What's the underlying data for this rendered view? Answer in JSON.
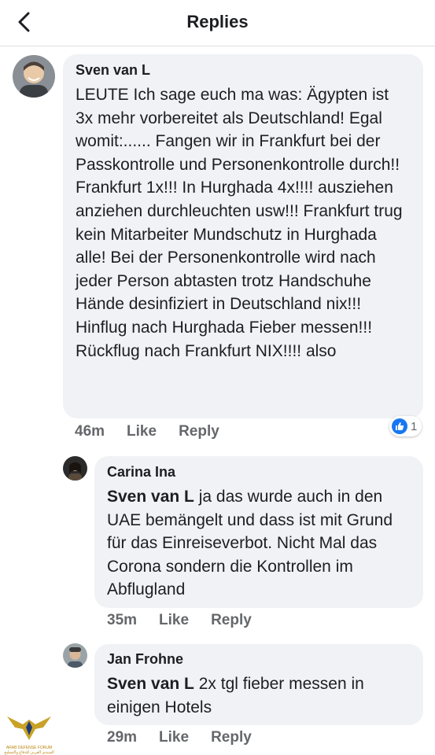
{
  "header": {
    "title": "Replies"
  },
  "comments": [
    {
      "author": "Sven van L",
      "text": "LEUTE Ich sage euch ma was: Ägypten ist 3x mehr vorbereitet als Deutschland! Egal womit:...... Fangen wir in Frankfurt bei der Passkontrolle und Personenkontrolle durch!!  Frankfurt 1x!!!  In Hurghada 4x!!!! ausziehen anziehen durchleuchten usw!!! Frankfurt trug kein Mitarbeiter Mundschutz in Hurghada alle! Bei der Personenkontrolle wird nach jeder Person abtasten trotz Handschuhe Hände desinfiziert in Deutschland nix!!! Hinflug nach Hurghada Fieber messen!!! Rückflug nach Frankfurt NIX!!!!  also",
      "time": "46m",
      "like": "Like",
      "reply": "Reply",
      "reaction_count": "1"
    },
    {
      "author": "Carina Ina",
      "mention": "Sven van L",
      "text": " ja das wurde auch in den UAE bemängelt und dass ist mit Grund für das Einreiseverbot. Nicht Mal das Corona sondern die Kontrollen im Abflugland",
      "time": "35m",
      "like": "Like",
      "reply": "Reply"
    },
    {
      "author": "Jan Frohne",
      "mention": "Sven van L",
      "text": " 2x tgl fieber messen in einigen Hotels",
      "time": "29m",
      "like": "Like",
      "reply": "Reply"
    }
  ],
  "watermark": {
    "line1": "ARAB DEFENSE FORUM",
    "line2": "المنتدى العربي للدفاع والتسليح"
  },
  "colors": {
    "bubble": "#f0f2f5",
    "meta": "#65676b",
    "like_blue": "#1877f2"
  }
}
